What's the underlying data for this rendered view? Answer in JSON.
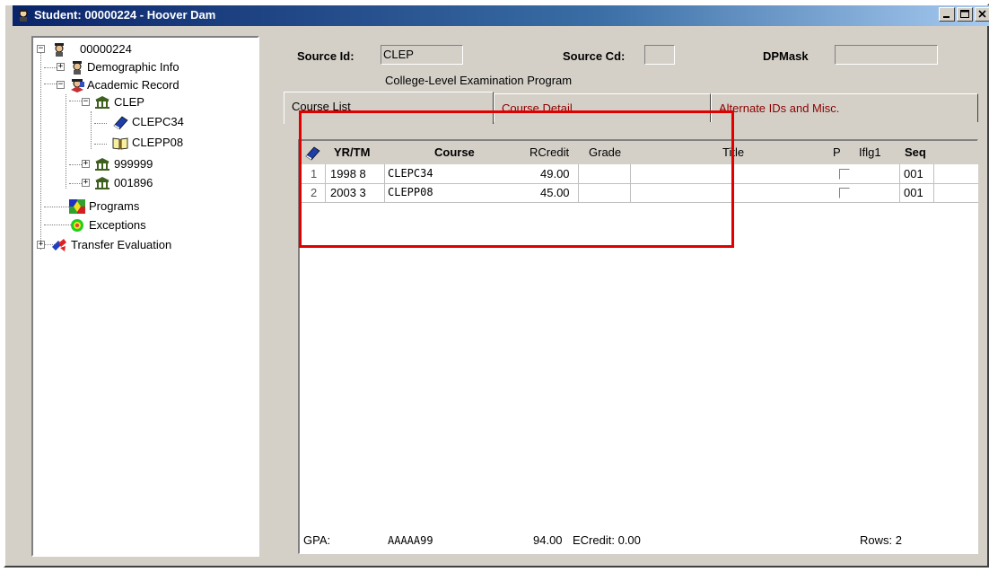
{
  "window": {
    "title": "Student: 00000224 - Hoover Dam",
    "buttons": [
      "_",
      "□",
      "×"
    ]
  },
  "tree": {
    "root": "00000224",
    "nodes": {
      "demographic": "Demographic Info",
      "academic": "Academic Record",
      "clep": "CLEP",
      "clepc34": "CLEPC34",
      "clepp08": "CLEPP08",
      "n999999": "999999",
      "n001896": "001896",
      "programs": "Programs",
      "exceptions": "Exceptions",
      "transfer": "Transfer Evaluation"
    },
    "expanders": {
      "root": "−",
      "demographic": "+",
      "academic": "−",
      "clep": "−",
      "n999999": "+",
      "n001896": "+",
      "transfer": "+"
    }
  },
  "header": {
    "source_id_label": "Source Id:",
    "source_id_value": "CLEP",
    "source_cd_label": "Source Cd:",
    "source_cd_value": "",
    "dpmask_label": "DPMask",
    "dpmask_value": "",
    "source_description": "College-Level Examination Program"
  },
  "tabs": [
    {
      "label": "Course List",
      "active": true
    },
    {
      "label": "Course Detail",
      "active": false
    },
    {
      "label": "Alternate IDs and Misc.",
      "active": false
    }
  ],
  "grid": {
    "columns": [
      "YR/TM",
      "Course",
      "RCredit",
      "Grade",
      "Title",
      "P",
      "Iflg1",
      "Seq"
    ],
    "rows": [
      {
        "num": "1",
        "yrtm": "1998 8",
        "course": "CLEPC34",
        "rcredit": "49.00",
        "grade": "",
        "title": "",
        "p": false,
        "iflg1": "",
        "seq": "001"
      },
      {
        "num": "2",
        "yrtm": "2003 3",
        "course": "CLEPP08",
        "rcredit": "45.00",
        "grade": "",
        "title": "",
        "p": false,
        "iflg1": "",
        "seq": "001"
      }
    ]
  },
  "footer": {
    "gpa_label": "GPA:",
    "gpa_value": "AAAAA99",
    "credit_total": "94.00",
    "ecredit": "ECredit: 0.00",
    "rows": "Rows: 2"
  },
  "colors": {
    "highlight_box": "#e00000",
    "inactive_tab_text": "#8b0000",
    "title_bar": "#0a246a"
  }
}
